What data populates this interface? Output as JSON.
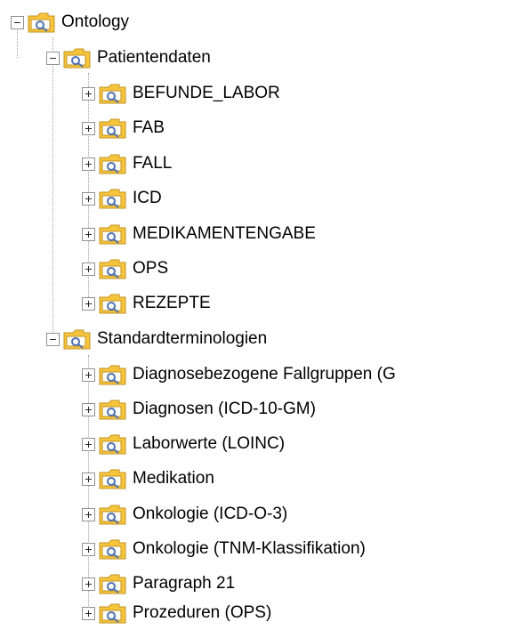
{
  "tree": {
    "root": {
      "label": "Ontology",
      "expanded": true,
      "children": [
        {
          "label": "Patientendaten",
          "expanded": true,
          "children": [
            {
              "label": "BEFUNDE_LABOR"
            },
            {
              "label": "FAB"
            },
            {
              "label": "FALL"
            },
            {
              "label": "ICD"
            },
            {
              "label": "MEDIKAMENTENGABE"
            },
            {
              "label": "OPS"
            },
            {
              "label": "REZEPTE"
            }
          ]
        },
        {
          "label": "Standardterminologien",
          "expanded": true,
          "children": [
            {
              "label": "Diagnosebezogene Fallgruppen (G"
            },
            {
              "label": "Diagnosen (ICD-10-GM)"
            },
            {
              "label": "Laborwerte (LOINC)"
            },
            {
              "label": "Medikation"
            },
            {
              "label": "Onkologie (ICD-O-3)"
            },
            {
              "label": "Onkologie (TNM-Klassifikation)"
            },
            {
              "label": "Paragraph 21"
            },
            {
              "label": "Prozeduren (OPS)"
            }
          ]
        }
      ]
    }
  },
  "icons": {
    "collapse": "minus-icon",
    "expand": "plus-icon",
    "folder": "folder-icon"
  }
}
